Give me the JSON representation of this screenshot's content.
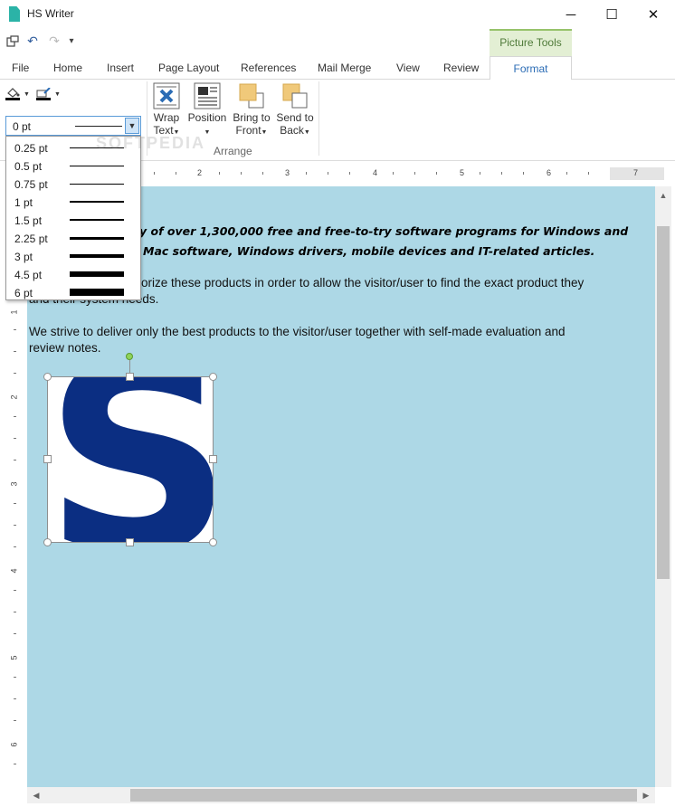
{
  "window": {
    "title": "HS Writer",
    "min": "─",
    "max": "☐",
    "close": "✕"
  },
  "qat": {
    "layout_icon": "layout-icon",
    "undo": "↶",
    "redo": "↷",
    "customize": "▾"
  },
  "ribbon": {
    "context_group": "Picture Tools",
    "tabs": [
      "File",
      "Home",
      "Insert",
      "Page Layout",
      "References",
      "Mail Merge",
      "View",
      "Review"
    ],
    "active_tab": "Format",
    "arrange": {
      "label": "Arrange",
      "wrap_text": [
        "Wrap",
        "Text"
      ],
      "position": [
        "Position",
        ""
      ],
      "bring_to_front": [
        "Bring to",
        "Front"
      ],
      "send_to_back": [
        "Send to",
        "Back"
      ]
    }
  },
  "outline_weight": {
    "current": "0 pt",
    "options": [
      "0.25 pt",
      "0.5 pt",
      "0.75 pt",
      "1 pt",
      "1.5 pt",
      "2.25 pt",
      "3 pt",
      "4.5 pt",
      "6 pt"
    ],
    "option_weights": [
      0.25,
      0.5,
      0.75,
      1,
      1.5,
      2.25,
      3,
      4.5,
      6
    ]
  },
  "ruler": {
    "h_numbers": [
      "1",
      "2",
      "3",
      "4",
      "5",
      "6",
      "7"
    ],
    "v_numbers": [
      "1",
      "2",
      "3",
      "4",
      "5",
      "6"
    ]
  },
  "document": {
    "heading_line1": "y of over 1,300,000 free and free-to-try software programs for Windows and",
    "heading_line2": "Mac software, Windows drivers, mobile devices and IT-related articles.",
    "para1_line1": "orize these products in order to allow the visitor/user to find the exact product they",
    "para1_line2": "and their system needs.",
    "para2_line1": "We strive to deliver only the best products to the visitor/user together with self-made evaluation and",
    "para2_line2": "review notes.",
    "image_letter": "S",
    "background": "#add8e6",
    "logo_color": "#0b2e82"
  },
  "watermark": "SOFTPEDIA"
}
